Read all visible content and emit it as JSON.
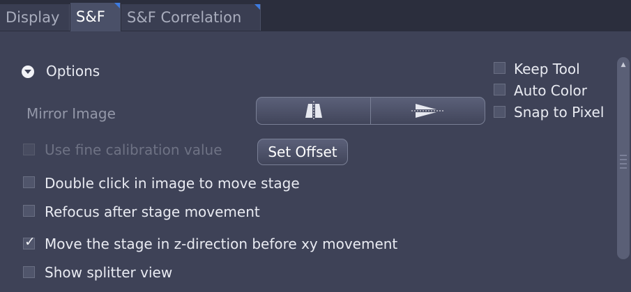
{
  "tabs": [
    {
      "label": "Display",
      "active": false
    },
    {
      "label": "S&F",
      "active": true
    },
    {
      "label": "S&F Correlation",
      "active": false
    }
  ],
  "options": {
    "header_label": "Options",
    "mirror_image_label": "Mirror Image",
    "mirror_buttons": [
      "flip-horizontal-icon",
      "flip-vertical-icon"
    ],
    "fine_calibration": {
      "label": "Use fine calibration value",
      "checked": false,
      "enabled": false
    },
    "set_offset_label": "Set Offset",
    "checkboxes": [
      {
        "label": "Double click in image to move stage",
        "checked": false
      },
      {
        "label": "Refocus after stage movement",
        "checked": false
      },
      {
        "label": "Move the stage in z-direction before xy movement",
        "checked": true
      },
      {
        "label": "Show splitter view",
        "checked": false
      }
    ]
  },
  "side_options": [
    {
      "label": "Keep Tool",
      "checked": false
    },
    {
      "label": "Auto Color",
      "checked": false
    },
    {
      "label": "Snap to Pixel",
      "checked": false
    }
  ],
  "colors": {
    "background": "#3e4257",
    "tab_accent": "#3d7be0"
  }
}
